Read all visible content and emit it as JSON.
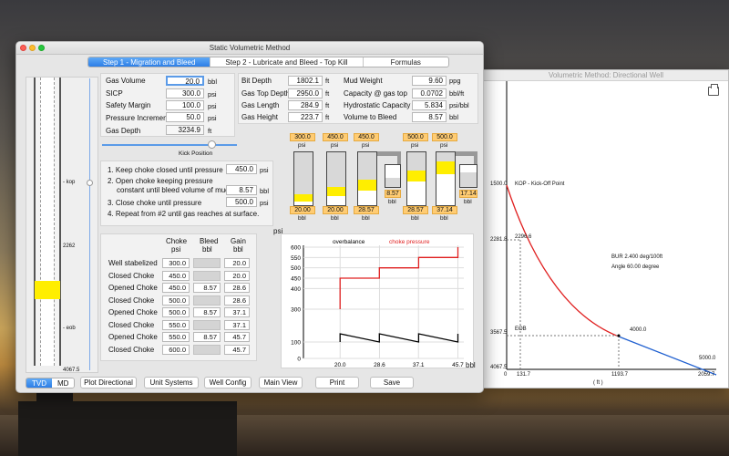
{
  "window": {
    "title": "Static Volumetric Method"
  },
  "tabs": [
    {
      "label": "Step 1 - Migration and Bleed",
      "active": true
    },
    {
      "label": "Step 2 - Lubricate and Bleed - Top Kill",
      "active": false
    },
    {
      "label": "Formulas",
      "active": false
    }
  ],
  "inputs": {
    "gas_volume": {
      "label": "Gas Volume",
      "value": "20.0",
      "unit": "bbl"
    },
    "sicp": {
      "label": "SICP",
      "value": "300.0",
      "unit": "psi"
    },
    "safety_margin": {
      "label": "Safety Margin",
      "value": "100.0",
      "unit": "psi"
    },
    "pressure_increment": {
      "label": "Pressure Increment",
      "value": "50.0",
      "unit": "psi"
    },
    "gas_depth": {
      "label": "Gas Depth",
      "value": "3234.9",
      "unit": "ft"
    },
    "bit_depth": {
      "label": "Bit Depth",
      "value": "1802.1",
      "unit": "ft"
    },
    "gas_top_depth": {
      "label": "Gas Top Depth",
      "value": "2950.0",
      "unit": "ft"
    },
    "gas_length": {
      "label": "Gas Length",
      "value": "284.9",
      "unit": "ft"
    },
    "gas_height": {
      "label": "Gas Height",
      "value": "223.7",
      "unit": "ft"
    },
    "mud_weight": {
      "label": "Mud Weight",
      "value": "9.60",
      "unit": "ppg"
    },
    "capacity_gas_top": {
      "label": "Capacity @ gas top",
      "value": "0.0702",
      "unit": "bbl/ft"
    },
    "hydrostatic_capacity": {
      "label": "Hydrostatic Capacity",
      "value": "5.834",
      "unit": "psi/bbl"
    },
    "volume_to_bleed": {
      "label": "Volume to Bleed",
      "value": "8.57",
      "unit": "bbl"
    }
  },
  "kick_position": {
    "label": "Kick Position",
    "level": 0.55
  },
  "steps": {
    "s1": "1. Keep choke closed until pressure",
    "s1_value": "450.0",
    "s1_unit": "psi",
    "s2a": "2. Open choke keeping pressure",
    "s2b": "constant until bleed volume of mud",
    "s2_value": "8.57",
    "s2_unit": "bbl",
    "s3": "3. Close choke until pressure",
    "s3_value": "500.0",
    "s3_unit": "psi",
    "s4": "4. Repeat from #2 until gas reaches at surface."
  },
  "tanks": [
    {
      "top": "300.0",
      "top_unit": "psi",
      "bottom": "20.00",
      "bottom_unit": "bbl"
    },
    {
      "top": "450.0",
      "top_unit": "psi",
      "bottom": "20.00",
      "bottom_unit": "bbl"
    },
    {
      "top": "450.0",
      "top_unit": "psi",
      "bottom": "28.57",
      "bottom_unit": "bbl",
      "side": "8.57",
      "side_unit": "bbl"
    },
    {
      "top": "500.0",
      "top_unit": "psi",
      "bottom": "28.57",
      "bottom_unit": "bbl"
    },
    {
      "top": "500.0",
      "top_unit": "psi",
      "bottom": "37.14",
      "bottom_unit": "bbl",
      "side": "17.14",
      "side_unit": "bbl"
    }
  ],
  "table": {
    "headers": {
      "choke": "Choke",
      "choke_unit": "psi",
      "bleed": "Bleed",
      "bleed_unit": "bbl",
      "gain": "Gain",
      "gain_unit": "bbl"
    },
    "rows": [
      {
        "label": "Well stabelized",
        "choke": "300.0",
        "bleed": "",
        "gain": "20.0"
      },
      {
        "label": "Closed Choke",
        "choke": "450.0",
        "bleed": "",
        "gain": "20.0"
      },
      {
        "label": "Opened Choke",
        "choke": "450.0",
        "bleed": "8.57",
        "gain": "28.6"
      },
      {
        "label": "Closed Choke",
        "choke": "500.0",
        "bleed": "",
        "gain": "28.6"
      },
      {
        "label": "Opened Choke",
        "choke": "500.0",
        "bleed": "8.57",
        "gain": "37.1"
      },
      {
        "label": "Closed Choke",
        "choke": "550.0",
        "bleed": "",
        "gain": "37.1"
      },
      {
        "label": "Opened Choke",
        "choke": "550.0",
        "bleed": "8.57",
        "gain": "45.7"
      },
      {
        "label": "Closed Choke",
        "choke": "600.0",
        "bleed": "",
        "gain": "45.7"
      }
    ]
  },
  "chart_data": {
    "type": "line",
    "ylabel": "psi",
    "xlabel": "bbl",
    "legend": [
      "overbalance",
      "choke pressure"
    ],
    "colors": {
      "overbalance": "#000000",
      "choke_pressure": "#e02020"
    },
    "yticks": [
      "600",
      "550",
      "500",
      "450",
      "400",
      "300",
      "100",
      "0"
    ],
    "xticks": [
      "20.0",
      "28.6",
      "37.1",
      "45.7"
    ],
    "series": [
      {
        "name": "choke pressure",
        "points": [
          [
            20.0,
            300
          ],
          [
            20.0,
            450
          ],
          [
            28.57,
            450
          ],
          [
            28.57,
            500
          ],
          [
            37.14,
            500
          ],
          [
            37.14,
            550
          ],
          [
            45.71,
            550
          ],
          [
            45.71,
            600
          ]
        ]
      },
      {
        "name": "overbalance",
        "points": [
          [
            20.0,
            100
          ],
          [
            20.0,
            150
          ],
          [
            28.57,
            100
          ],
          [
            28.57,
            150
          ],
          [
            37.14,
            100
          ],
          [
            37.14,
            150
          ],
          [
            45.71,
            100
          ],
          [
            45.71,
            150
          ]
        ]
      }
    ]
  },
  "well": {
    "labels": {
      "kop": "- kop",
      "eob": "- eob",
      "depth_top": "2262",
      "depth_bottom": "4067.5"
    }
  },
  "mode_buttons": {
    "tvd": "TVD",
    "md": "MD"
  },
  "bottom_buttons": [
    "Plot Directional",
    "Unit Systems",
    "Well Config",
    "Main View",
    "Print",
    "Save"
  ],
  "directional": {
    "title": "Volumetric Method: Directional Well",
    "kop_label": "KOP - Kick-Off Point",
    "y_labels": {
      "kop": "1500.0",
      "p2": "2281.8",
      "eob": "3567.5",
      "bottom": "4067.5"
    },
    "x_labels": {
      "x0": "0",
      "x1": "131.7",
      "x2": "1193.7",
      "x3": "2059.7"
    },
    "points": {
      "ssd": "2296.6",
      "eob": "EOB",
      "p4000": "4000.0",
      "p5000": "5000.0"
    },
    "bur": "BUR 2.400 deg/100ft",
    "angle": "Angle 60.00 degree",
    "units": "( ft )"
  }
}
